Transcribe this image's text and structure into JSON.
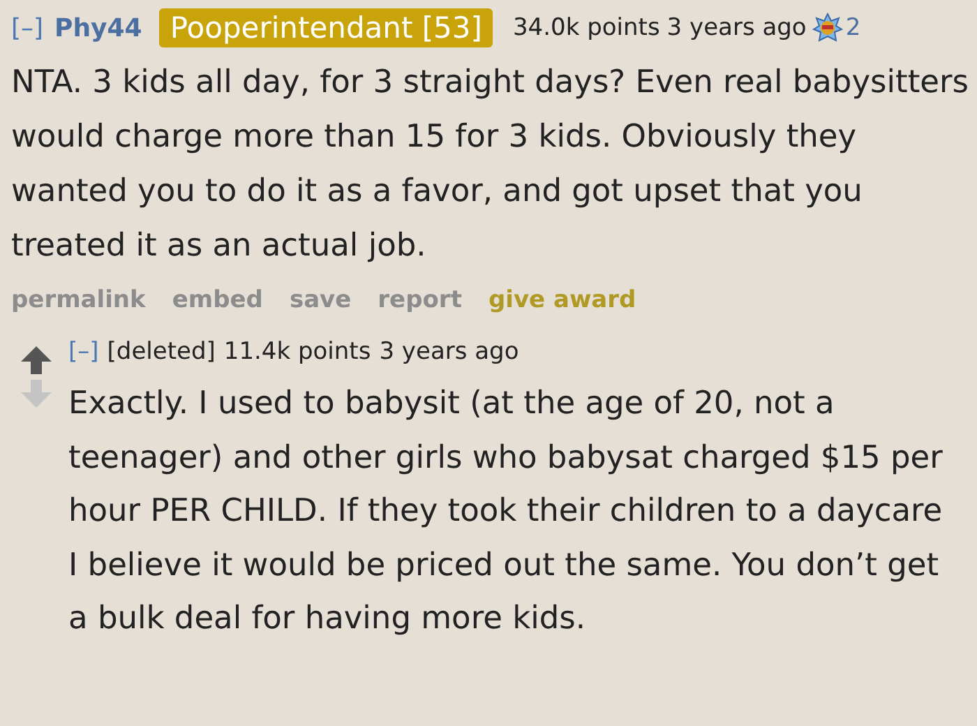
{
  "comment": {
    "collapse": "[–]",
    "author": "Phy44",
    "flair": "Pooperintendant [53]",
    "score": "34.0k points",
    "time": "3 years ago",
    "award_count": "2",
    "body": "NTA. 3 kids all day, for 3 straight days? Even real babysitters would charge more than 15 for 3 kids. Obviously they wanted you to do it as a favor, and got upset that you treated it as an actual job.",
    "actions": [
      {
        "label": "permalink",
        "kind": "plain"
      },
      {
        "label": "embed",
        "kind": "plain"
      },
      {
        "label": "save",
        "kind": "plain"
      },
      {
        "label": "report",
        "kind": "plain"
      },
      {
        "label": "give award",
        "kind": "award"
      }
    ]
  },
  "reply": {
    "collapse": "[–]",
    "author": "[deleted]",
    "score": "11.4k points",
    "time": "3 years ago",
    "upvoted": false,
    "downvoted": false,
    "body": "Exactly. I used to babysit (at the age of 20, not a teenager) and other girls who babysat charged $15 per hour PER CHILD. If they took their children to a daycare I believe it would be priced out the same. You don’t get a bulk deal for having more kids."
  }
}
